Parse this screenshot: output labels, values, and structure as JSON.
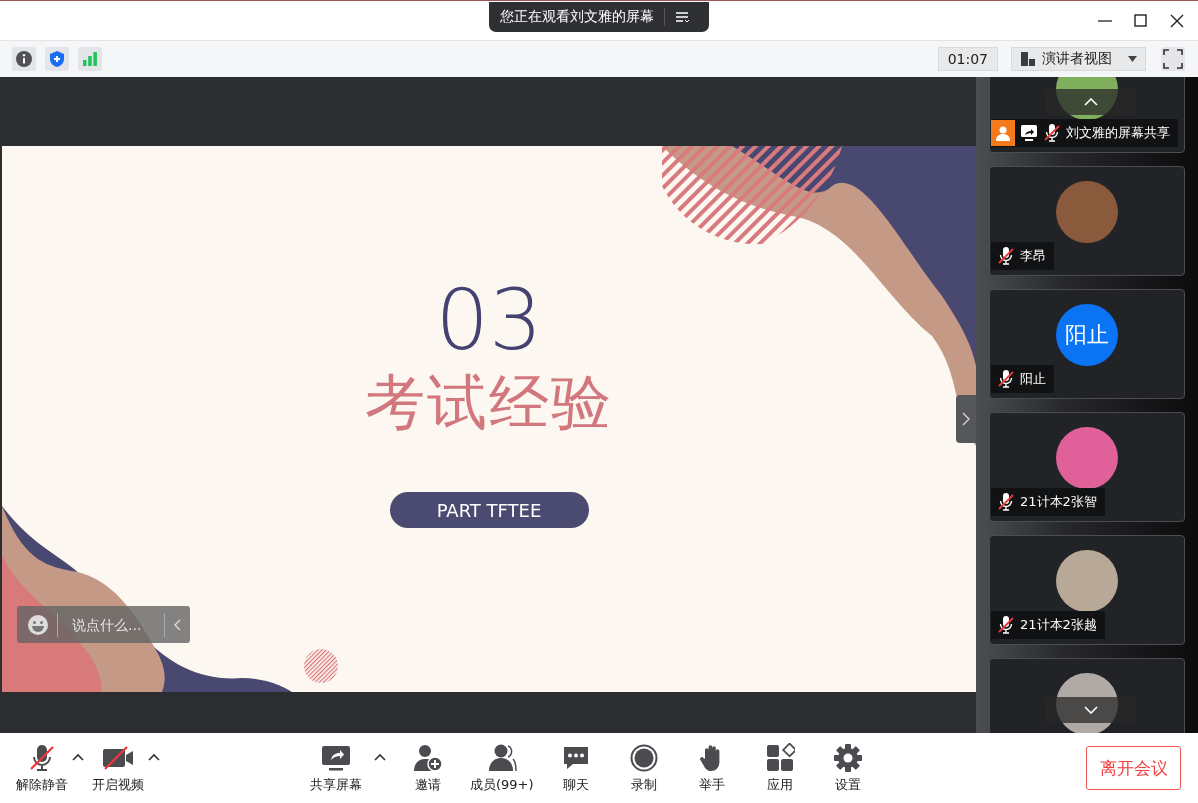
{
  "banner": {
    "text": "您正在观看刘文雅的屏幕"
  },
  "status_icons": [
    {
      "kind": "info"
    },
    {
      "kind": "shield"
    },
    {
      "kind": "signal"
    }
  ],
  "timer": "01:07",
  "view_menu": {
    "label": "演讲者视图"
  },
  "slide": {
    "number": "03",
    "title": "考试经验",
    "subtitle": "PART TFTEE"
  },
  "chat_input": {
    "placeholder": "说点什么..."
  },
  "participants": [
    {
      "name": "刘文雅的屏幕共享",
      "muted": true,
      "host": true,
      "sharing": true,
      "avatar": {
        "kind": "photo",
        "color": "#7fae5c"
      }
    },
    {
      "name": "李昂",
      "muted": true,
      "avatar": {
        "kind": "photo",
        "color": "#8a5a3c"
      }
    },
    {
      "name": "阳止",
      "muted": true,
      "avatar": {
        "kind": "text",
        "text": "阳止",
        "color": "#0a74f5"
      }
    },
    {
      "name": "21计本2张智",
      "muted": true,
      "avatar": {
        "kind": "photo",
        "color": "#e0609a"
      }
    },
    {
      "name": "21计本2张越",
      "muted": true,
      "avatar": {
        "kind": "photo",
        "color": "#b8a898"
      }
    },
    {
      "avatar": {
        "kind": "photo",
        "color": "#b0aaa6"
      }
    }
  ],
  "left_tools": [
    {
      "kind": "mic",
      "label": "解除静音",
      "off": true,
      "menu": true
    },
    {
      "kind": "camera",
      "label": "开启视频",
      "off": true,
      "menu": true
    }
  ],
  "center_tools": [
    {
      "kind": "share",
      "label": "共享屏幕",
      "menu": true
    },
    {
      "kind": "invite",
      "label": "邀请"
    },
    {
      "kind": "members",
      "label": "成员(99+)"
    },
    {
      "kind": "chat",
      "label": "聊天"
    },
    {
      "kind": "record",
      "label": "录制"
    },
    {
      "kind": "hand",
      "label": "举手"
    },
    {
      "kind": "apps",
      "label": "应用"
    },
    {
      "kind": "settings",
      "label": "设置"
    }
  ],
  "leave_button": {
    "label": "离开会议"
  }
}
